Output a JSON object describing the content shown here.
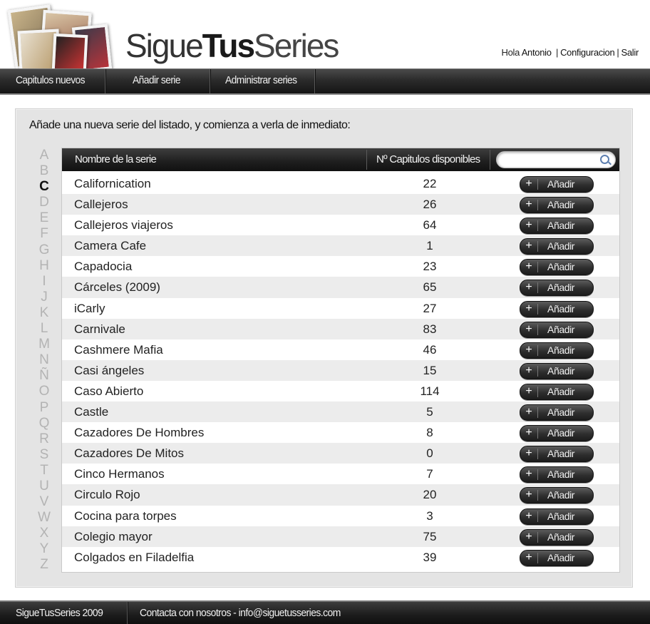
{
  "header": {
    "brand_sigue": "Sigue",
    "brand_tus": "Tus",
    "brand_series": "Series",
    "greeting": "Hola",
    "user": "Antonio",
    "separator": "|",
    "config_link": "Configuracion",
    "logout_link": "Salir"
  },
  "nav": {
    "items": [
      "Capitulos nuevos",
      "Añadir serie",
      "Administrar series"
    ]
  },
  "main": {
    "intro": "Añade una nueva serie del listado, y comienza a verla de inmediato:",
    "alphabet": [
      "A",
      "B",
      "C",
      "D",
      "E",
      "F",
      "G",
      "H",
      "I",
      "J",
      "K",
      "L",
      "M",
      "N",
      "Ñ",
      "O",
      "P",
      "Q",
      "R",
      "S",
      "T",
      "U",
      "V",
      "W",
      "X",
      "Y",
      "Z"
    ],
    "active_letter": "C",
    "table": {
      "col_name": "Nombre de la serie",
      "col_count": "Nº Capitulos disponibles",
      "search_placeholder": "",
      "add_plus": "+",
      "add_label": "Añadir",
      "rows": [
        {
          "name": "Californication",
          "count": "22"
        },
        {
          "name": "Callejeros",
          "count": "26"
        },
        {
          "name": "Callejeros viajeros",
          "count": "64"
        },
        {
          "name": "Camera Cafe",
          "count": "1"
        },
        {
          "name": "Capadocia",
          "count": "23"
        },
        {
          "name": "Cárceles (2009)",
          "count": "65"
        },
        {
          "name": "iCarly",
          "count": "27"
        },
        {
          "name": "Carnivale",
          "count": "83"
        },
        {
          "name": "Cashmere Mafia",
          "count": "46"
        },
        {
          "name": "Casi ángeles",
          "count": "15"
        },
        {
          "name": "Caso Abierto",
          "count": "114"
        },
        {
          "name": "Castle",
          "count": "5"
        },
        {
          "name": "Cazadores De Hombres",
          "count": "8"
        },
        {
          "name": "Cazadores De Mitos",
          "count": "0"
        },
        {
          "name": "Cinco Hermanos",
          "count": "7"
        },
        {
          "name": "Circulo Rojo",
          "count": "20"
        },
        {
          "name": "Cocina para torpes",
          "count": "3"
        },
        {
          "name": "Colegio mayor",
          "count": "75"
        },
        {
          "name": "Colgados en Filadelfia",
          "count": "39"
        }
      ]
    }
  },
  "footer": {
    "copyright": "SigueTusSeries 2009",
    "contact": "Contacta con nosotros - info@siguetusseries.com"
  },
  "colors": {
    "bar_dark": "#1e1e1e",
    "panel_bg": "#e4e4e4",
    "inactive_letter": "#b3b3b3",
    "active_letter": "#111111"
  },
  "icons": [
    "photo-collage-logo",
    "search-icon",
    "plus-icon"
  ]
}
